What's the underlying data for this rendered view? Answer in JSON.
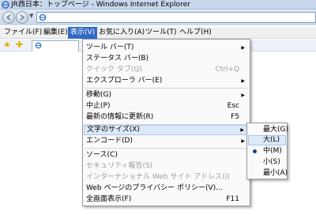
{
  "window": {
    "title": "JR西日本：トップページ - Windows Internet Explorer"
  },
  "menubar": {
    "items": [
      {
        "label": "ファイル(F)",
        "active": false
      },
      {
        "label": "編集(E)",
        "active": false
      },
      {
        "label": "表示(V)",
        "active": true
      },
      {
        "label": "お気に入り(A)",
        "active": false
      },
      {
        "label": "ツール(T)",
        "active": false
      },
      {
        "label": "ヘルプ(H)",
        "active": false
      }
    ]
  },
  "view_menu": {
    "items": [
      {
        "label": "ツール バー(T)",
        "shortcut": "",
        "submenu": true,
        "disabled": false
      },
      {
        "label": "ステータス バー(B)",
        "shortcut": "",
        "submenu": false,
        "disabled": false
      },
      {
        "label": "クイック タブ(Q)",
        "shortcut": "Ctrl+Q",
        "submenu": false,
        "disabled": true
      },
      {
        "label": "エクスプローラ バー(E)",
        "shortcut": "",
        "submenu": true,
        "disabled": false
      },
      {
        "label": "移動(G)",
        "shortcut": "",
        "submenu": true,
        "disabled": false
      },
      {
        "label": "中止(P)",
        "shortcut": "Esc",
        "submenu": false,
        "disabled": false
      },
      {
        "label": "最新の情報に更新(R)",
        "shortcut": "F5",
        "submenu": false,
        "disabled": false
      },
      {
        "label": "文字のサイズ(X)",
        "shortcut": "",
        "submenu": true,
        "disabled": false,
        "highlighted": true
      },
      {
        "label": "エンコード(D)",
        "shortcut": "",
        "submenu": true,
        "disabled": false
      },
      {
        "label": "ソース(C)",
        "shortcut": "",
        "submenu": false,
        "disabled": false
      },
      {
        "label": "セキュリティ報告(S)",
        "shortcut": "",
        "submenu": false,
        "disabled": true
      },
      {
        "label": "インターナショナル Web サイト アドレス(I)",
        "shortcut": "",
        "submenu": false,
        "disabled": true
      },
      {
        "label": "Web ページのプライバシー ポリシー(V)...",
        "shortcut": "",
        "submenu": false,
        "disabled": false
      },
      {
        "label": "全画面表示(F)",
        "shortcut": "F11",
        "submenu": false,
        "disabled": false
      }
    ]
  },
  "text_size_submenu": {
    "items": [
      {
        "label": "最大(G)",
        "selected": false,
        "highlighted": false
      },
      {
        "label": "大(L)",
        "selected": false,
        "highlighted": true
      },
      {
        "label": "中(M)",
        "selected": true,
        "highlighted": false
      },
      {
        "label": "小(S)",
        "selected": false,
        "highlighted": false
      },
      {
        "label": "最小(A)",
        "selected": false,
        "highlighted": false
      }
    ]
  },
  "icons": {
    "back": "back-arrow-icon",
    "forward": "forward-arrow-icon",
    "history": "dropdown-arrow-icon",
    "favorites_star": "favorites-star-icon",
    "add_favorite": "add-favorite-icon",
    "page": "ie-page-icon"
  },
  "colors": {
    "menu_highlight": "#316ac5",
    "item_highlight": "#dce9f8"
  }
}
